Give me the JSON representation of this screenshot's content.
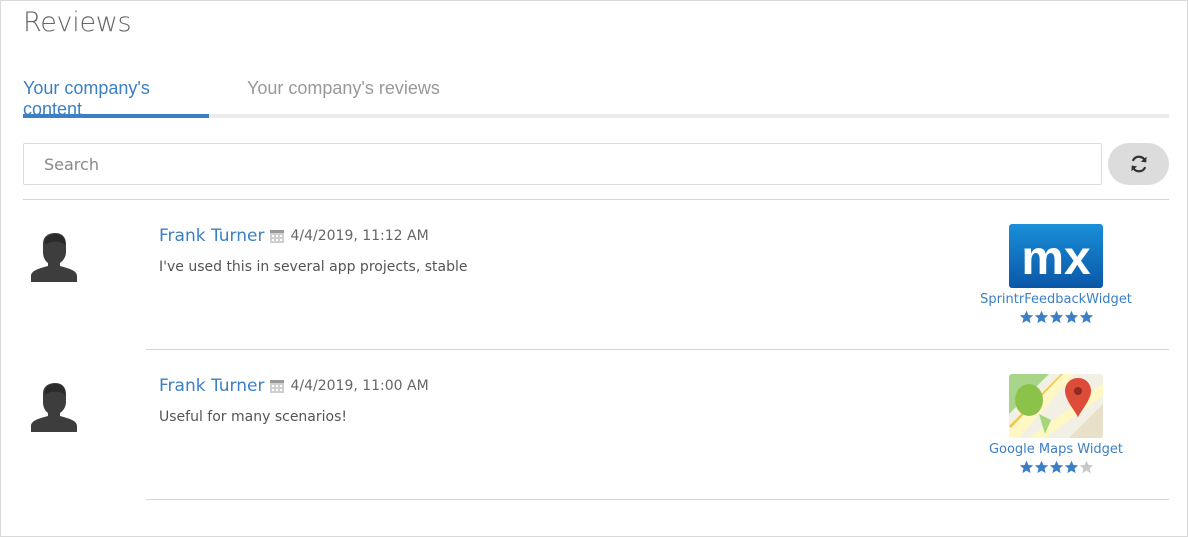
{
  "page": {
    "title": "Reviews"
  },
  "tabs": [
    {
      "label": "Your company's content",
      "active": true
    },
    {
      "label": "Your company's reviews",
      "active": false
    }
  ],
  "search": {
    "placeholder": "Search",
    "value": ""
  },
  "refresh": {
    "icon": "refresh-icon"
  },
  "colors": {
    "accent": "#3b7fc4",
    "star_filled": "#3b7fc4",
    "star_empty": "#c8c8c8"
  },
  "reviews": [
    {
      "author": "Frank Turner",
      "date": "4/4/2019, 11:12 AM",
      "text": "I've used this in several app projects, stable",
      "widget": {
        "name": "SprintrFeedbackWidget",
        "logo": "mx-logo",
        "logo_text": "mx",
        "rating": 5,
        "max_rating": 5
      }
    },
    {
      "author": "Frank Turner",
      "date": "4/4/2019, 11:00 AM",
      "text": "Useful for many scenarios!",
      "widget": {
        "name": "Google Maps Widget",
        "logo": "google-maps-logo",
        "rating": 4,
        "max_rating": 5
      }
    }
  ]
}
